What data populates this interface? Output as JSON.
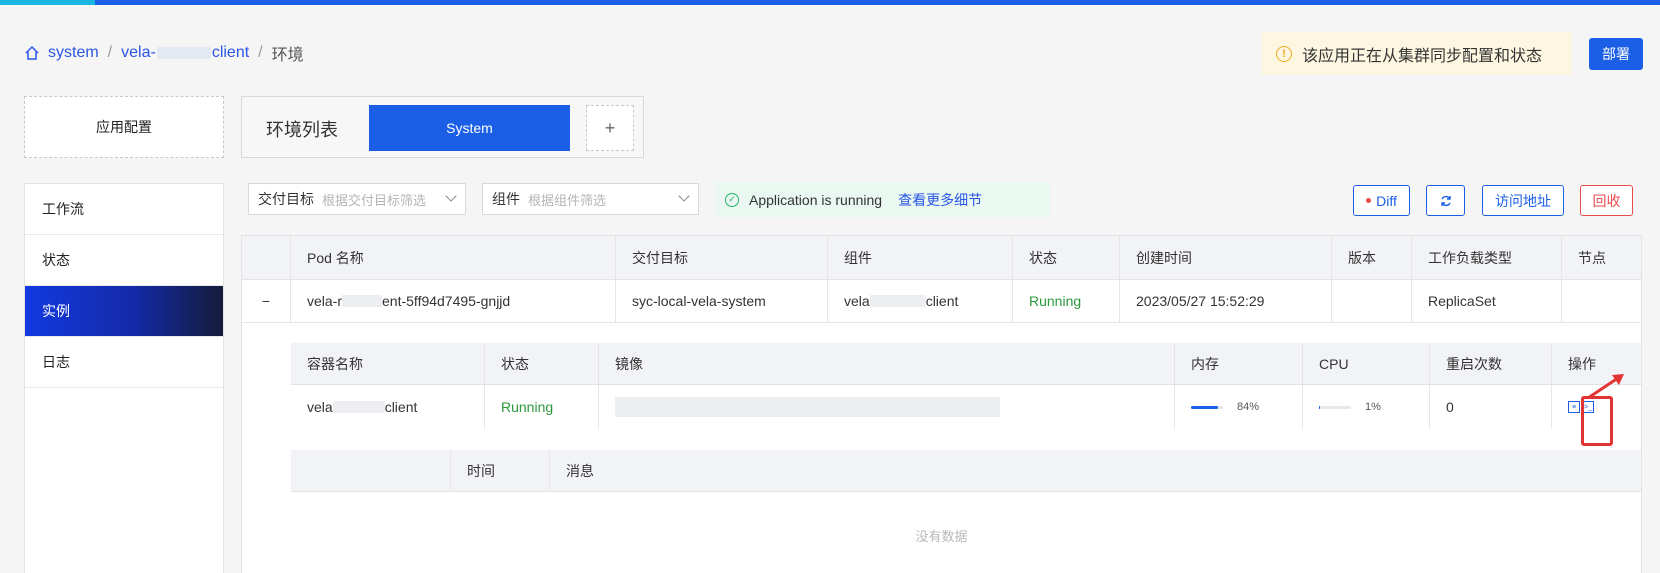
{
  "breadcrumb": {
    "items": [
      "system",
      "vela-",
      "client",
      "环境"
    ]
  },
  "notice": {
    "text": "该应用正在从集群同步配置和状态"
  },
  "deploy_button": {
    "label": "部署"
  },
  "app_config": {
    "label": "应用配置"
  },
  "env_list": {
    "title": "环境列表",
    "selected": "System",
    "add_label": "+"
  },
  "sidebar": {
    "items": [
      {
        "label": "工作流",
        "active": false
      },
      {
        "label": "状态",
        "active": false
      },
      {
        "label": "实例",
        "active": true
      },
      {
        "label": "日志",
        "active": false
      }
    ]
  },
  "filters": {
    "target": {
      "label": "交付目标",
      "placeholder": "根据交付目标筛选"
    },
    "component": {
      "label": "组件",
      "placeholder": "根据组件筛选"
    }
  },
  "status_banner": {
    "text": "Application is running",
    "link": "查看更多细节"
  },
  "actions": {
    "diff": "Diff",
    "refresh": "refresh-icon",
    "visit": "访问地址",
    "recycle": "回收"
  },
  "pod_table": {
    "headers": [
      "",
      "Pod 名称",
      "交付目标",
      "组件",
      "状态",
      "创建时间",
      "版本",
      "工作负载类型",
      "节点"
    ],
    "row": {
      "toggle": "−",
      "pod_name_a": "vela-r",
      "pod_name_b": "ent-5ff94d7495-gnjjd",
      "target": "syc-local-vela-system",
      "component_a": "vela",
      "component_b": "client",
      "status": "Running",
      "created": "2023/05/27 15:52:29",
      "version": "",
      "workload": "ReplicaSet",
      "node": ""
    }
  },
  "container_table": {
    "headers": [
      "容器名称",
      "状态",
      "镜像",
      "内存",
      "CPU",
      "重启次数",
      "操作"
    ],
    "row": {
      "name_a": "vela",
      "name_b": "client",
      "status": "Running",
      "memory": "84%",
      "memory_value": 0.84,
      "cpu": "1%",
      "cpu_value": 0.01,
      "restarts": "0"
    }
  },
  "event_table": {
    "headers": [
      "",
      "时间",
      "消息"
    ],
    "empty": "没有数据"
  },
  "colors": {
    "primary": "#1a5fe6",
    "success": "#2b9a3b",
    "danger": "#e84c4c",
    "warning": "#f0ad20"
  }
}
